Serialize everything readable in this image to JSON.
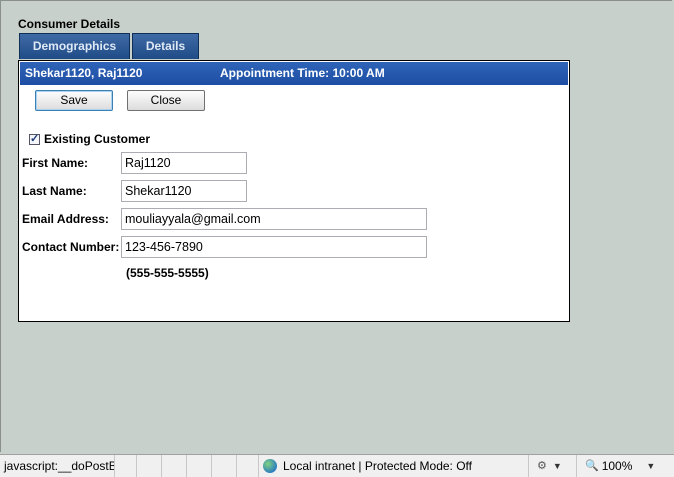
{
  "page": {
    "title": "Consumer Details",
    "tabs": [
      {
        "label": "Demographics"
      },
      {
        "label": "Details"
      }
    ]
  },
  "panel": {
    "header_name": "Shekar1120, Raj1120",
    "header_appointment": "Appointment Time: 10:00 AM",
    "buttons": {
      "save": "Save",
      "close": "Close"
    },
    "existing_customer": {
      "label": "Existing Customer",
      "checked": true
    },
    "fields": {
      "first_name": {
        "label": "First Name:",
        "value": "Raj1120"
      },
      "last_name": {
        "label": "Last Name:",
        "value": "Shekar1120"
      },
      "email": {
        "label": "Email Address:",
        "value": "mouliayyala@gmail.com"
      },
      "contact": {
        "label": "Contact Number:",
        "value": "123-456-7890"
      }
    },
    "phone_format_hint": "(555-555-5555)"
  },
  "statusbar": {
    "status_text": "javascript:__doPostBa",
    "zone_text": "Local intranet | Protected Mode: Off",
    "zoom": "100%",
    "icons": {
      "zone": "globe-icon",
      "security": "settings-icon",
      "zoom": "zoom-icon"
    }
  },
  "colors": {
    "tab_blue": "#1f4b86",
    "header_blue": "#2f64b8",
    "background": "#c8d0cc"
  }
}
